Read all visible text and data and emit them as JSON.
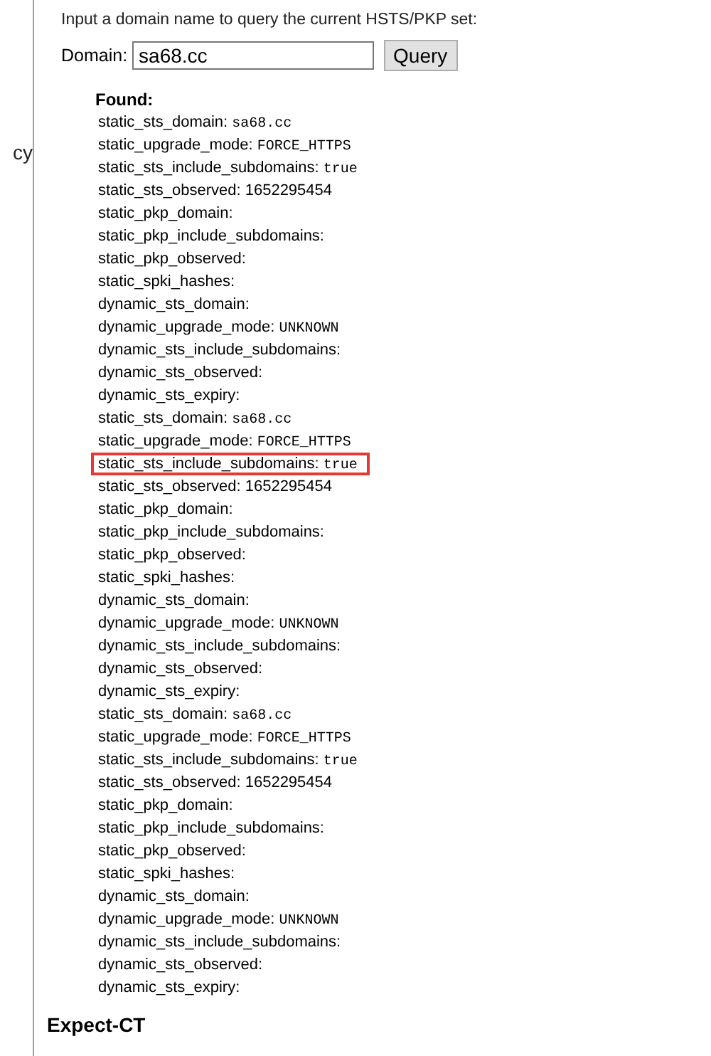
{
  "sidebar": {
    "item": "cy"
  },
  "intro": "Input a domain name to query the current HSTS/PKP set:",
  "query": {
    "label": "Domain:",
    "value": "sa68.cc",
    "button": "Query"
  },
  "result": {
    "heading": "Found:",
    "entries": [
      {
        "label": "static_sts_domain:",
        "value": "sa68.cc",
        "kind": "mono",
        "highlighted": false
      },
      {
        "label": "static_upgrade_mode:",
        "value": "FORCE_HTTPS",
        "kind": "mono",
        "highlighted": false
      },
      {
        "label": "static_sts_include_subdomains:",
        "value": "true",
        "kind": "mono",
        "highlighted": false
      },
      {
        "label": "static_sts_observed:",
        "value": "1652295454",
        "kind": "text",
        "highlighted": false
      },
      {
        "label": "static_pkp_domain:",
        "kind": "empty",
        "highlighted": false
      },
      {
        "label": "static_pkp_include_subdomains:",
        "kind": "empty",
        "highlighted": false
      },
      {
        "label": "static_pkp_observed:",
        "kind": "empty",
        "highlighted": false
      },
      {
        "label": "static_spki_hashes:",
        "kind": "empty",
        "highlighted": false
      },
      {
        "label": "dynamic_sts_domain:",
        "kind": "empty",
        "highlighted": false
      },
      {
        "label": "dynamic_upgrade_mode:",
        "value": "UNKNOWN",
        "kind": "mono",
        "highlighted": false
      },
      {
        "label": "dynamic_sts_include_subdomains:",
        "kind": "empty",
        "highlighted": false
      },
      {
        "label": "dynamic_sts_observed:",
        "kind": "empty",
        "highlighted": false
      },
      {
        "label": "dynamic_sts_expiry:",
        "kind": "empty",
        "highlighted": false
      },
      {
        "label": "static_sts_domain:",
        "value": "sa68.cc",
        "kind": "mono",
        "highlighted": false
      },
      {
        "label": "static_upgrade_mode:",
        "value": "FORCE_HTTPS",
        "kind": "mono",
        "highlighted": false
      },
      {
        "label": "static_sts_include_subdomains:",
        "value": "true",
        "kind": "mono",
        "highlighted": true
      },
      {
        "label": "static_sts_observed:",
        "value": "1652295454",
        "kind": "text",
        "highlighted": false
      },
      {
        "label": "static_pkp_domain:",
        "kind": "empty",
        "highlighted": false
      },
      {
        "label": "static_pkp_include_subdomains:",
        "kind": "empty",
        "highlighted": false
      },
      {
        "label": "static_pkp_observed:",
        "kind": "empty",
        "highlighted": false
      },
      {
        "label": "static_spki_hashes:",
        "kind": "empty",
        "highlighted": false
      },
      {
        "label": "dynamic_sts_domain:",
        "kind": "empty",
        "highlighted": false
      },
      {
        "label": "dynamic_upgrade_mode:",
        "value": "UNKNOWN",
        "kind": "mono",
        "highlighted": false
      },
      {
        "label": "dynamic_sts_include_subdomains:",
        "kind": "empty",
        "highlighted": false
      },
      {
        "label": "dynamic_sts_observed:",
        "kind": "empty",
        "highlighted": false
      },
      {
        "label": "dynamic_sts_expiry:",
        "kind": "empty",
        "highlighted": false
      },
      {
        "label": "static_sts_domain:",
        "value": "sa68.cc",
        "kind": "mono",
        "highlighted": false
      },
      {
        "label": "static_upgrade_mode:",
        "value": "FORCE_HTTPS",
        "kind": "mono",
        "highlighted": false
      },
      {
        "label": "static_sts_include_subdomains:",
        "value": "true",
        "kind": "mono",
        "highlighted": false
      },
      {
        "label": "static_sts_observed:",
        "value": "1652295454",
        "kind": "text",
        "highlighted": false
      },
      {
        "label": "static_pkp_domain:",
        "kind": "empty",
        "highlighted": false
      },
      {
        "label": "static_pkp_include_subdomains:",
        "kind": "empty",
        "highlighted": false
      },
      {
        "label": "static_pkp_observed:",
        "kind": "empty",
        "highlighted": false
      },
      {
        "label": "static_spki_hashes:",
        "kind": "empty",
        "highlighted": false
      },
      {
        "label": "dynamic_sts_domain:",
        "kind": "empty",
        "highlighted": false
      },
      {
        "label": "dynamic_upgrade_mode:",
        "value": "UNKNOWN",
        "kind": "mono",
        "highlighted": false
      },
      {
        "label": "dynamic_sts_include_subdomains:",
        "kind": "empty",
        "highlighted": false
      },
      {
        "label": "dynamic_sts_observed:",
        "kind": "empty",
        "highlighted": false
      },
      {
        "label": "dynamic_sts_expiry:",
        "kind": "empty",
        "highlighted": false
      }
    ]
  },
  "next_section": "Expect-CT"
}
